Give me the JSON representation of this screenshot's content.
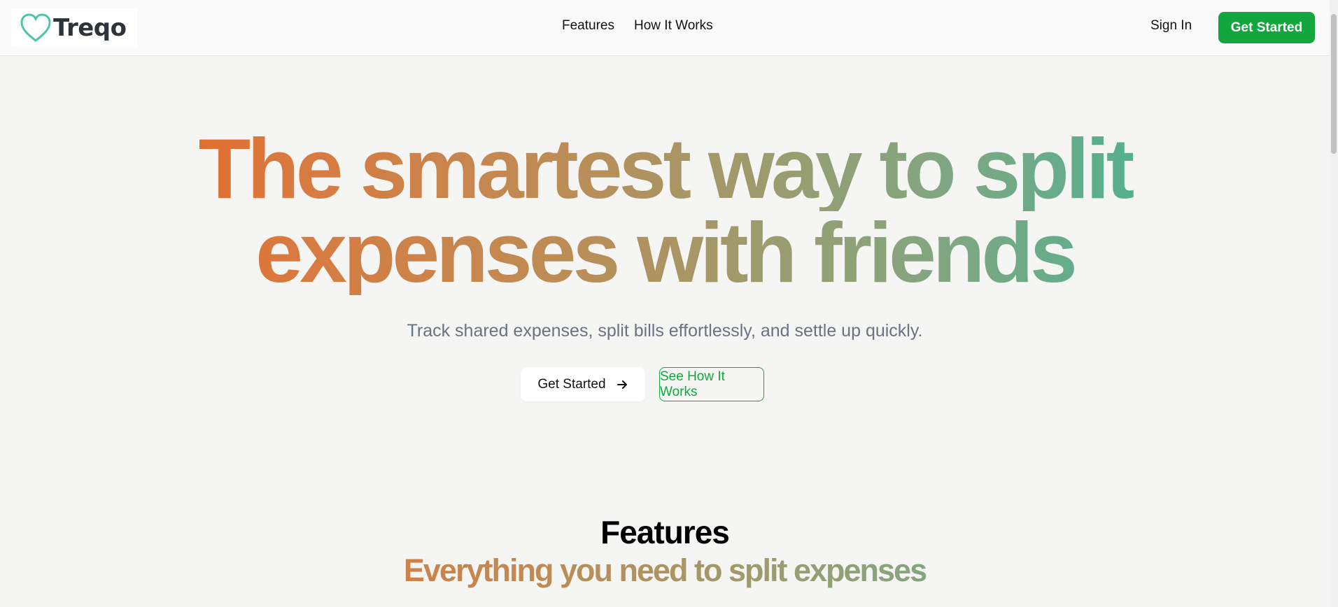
{
  "brand": {
    "name": "Treqo",
    "accent": "#13a63f"
  },
  "nav": {
    "links": [
      {
        "label": "Features"
      },
      {
        "label": "How It Works"
      }
    ],
    "sign_in": "Sign In",
    "cta": "Get Started"
  },
  "hero": {
    "line1": "The smartest way to split",
    "line2": "expenses with friends",
    "subtitle": "Track shared expenses, split bills effortlessly, and settle up quickly.",
    "primary_button": "Get Started",
    "secondary_button": "See How It Works",
    "gradient_colors": [
      "#ee5a0e",
      "#14b7a0"
    ]
  },
  "features": {
    "title": "Features",
    "subtitle": "Everything you need to split expenses"
  }
}
